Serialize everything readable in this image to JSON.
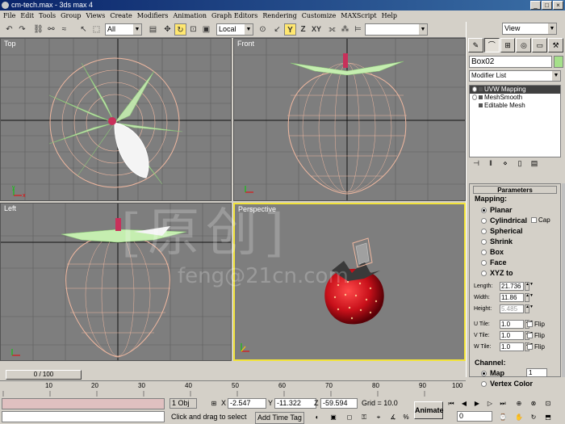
{
  "window": {
    "title": "cm-tech.max - 3ds max 4"
  },
  "menu": [
    "File",
    "Edit",
    "Tools",
    "Group",
    "Views",
    "Create",
    "Modifiers",
    "Animation",
    "Graph Editors",
    "Rendering",
    "Customize",
    "MAXScript",
    "Help"
  ],
  "toolbar": {
    "selection_filter": "All",
    "coord_system": "Local",
    "axis_y": "Y",
    "axis_z": "Z",
    "axis_xy": "XY",
    "named_selection": "",
    "view_dropdown": "View"
  },
  "viewports": {
    "top": "Top",
    "front": "Front",
    "left": "Left",
    "perspective": "Perspective"
  },
  "command_panel": {
    "object_name": "Box02",
    "modifier_list": "Modifier List",
    "stack": [
      "UVW Mapping",
      "MeshSmooth",
      "Editable Mesh"
    ],
    "rollout_title": "Parameters",
    "mapping": {
      "label": "Mapping:",
      "options": [
        "Planar",
        "Cylindrical",
        "Spherical",
        "Shrink",
        "Box",
        "Face",
        "XYZ to"
      ],
      "cap_label": "Cap",
      "selected": "Planar"
    },
    "length_label": "Length:",
    "length": "21.736",
    "width_label": "Width:",
    "width": "11.86",
    "height_label": "Height:",
    "height": "5.485",
    "utile_label": "U Tile:",
    "utile": "1.0",
    "vtile_label": "V Tile:",
    "vtile": "1.0",
    "wtile_label": "W Tile:",
    "wtile": "1.0",
    "flip_label": "Flip",
    "channel": {
      "label": "Channel:",
      "map_label": "Map",
      "map_value": "1",
      "vertex_color_label": "Vertex Color"
    }
  },
  "timeslider": {
    "frame": "0 / 100"
  },
  "ruler": [
    "10",
    "20",
    "30",
    "40",
    "50",
    "60",
    "70",
    "80",
    "90",
    "100"
  ],
  "status": {
    "selection_count": "1 Obj",
    "x_label": "X",
    "x": "-2.547",
    "y_label": "Y",
    "y": "-11.322",
    "z_label": "Z",
    "z": "-59.594",
    "grid": "Grid = 10.0",
    "prompt": "Click and drag to select",
    "add_time_tag": "Add Time Tag",
    "animate": "Animate",
    "frame_value": "0"
  },
  "watermark": {
    "line1": "[原创]",
    "line2": "feng@21cn.com"
  },
  "colors": {
    "viewport_bg": "#7e7e7e",
    "active_border": "#f2e33a",
    "wire_pink": "#f0b8a0",
    "leaf_green": "#b6e8a0",
    "strawberry_red": "#c8101a"
  }
}
